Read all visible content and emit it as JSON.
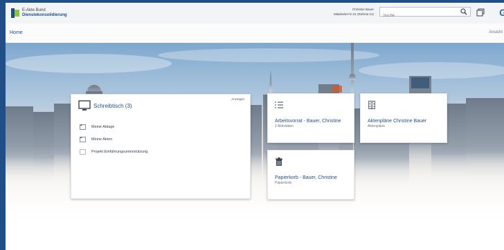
{
  "header": {
    "logo_line1": "E-Akte Bund",
    "logo_line2": "Dienstekonsolidierung",
    "user_name": "Christine Bauer",
    "user_role": "Mitarbeiter*in 21 (Referat 21)",
    "search_placeholder": "Suche",
    "brand_glyph": "G"
  },
  "breadcrumb": {
    "home": "Home",
    "view": "Ansicht"
  },
  "desk": {
    "title": "Schreibtisch (3)",
    "action": "Anzeigen",
    "items": [
      {
        "label": "Meine Ablage",
        "icon": "folder-icon"
      },
      {
        "label": "Meine Akten",
        "icon": "folder-icon"
      },
      {
        "label": "Projekt Einführungsunterstützung",
        "icon": "folder-icon"
      }
    ]
  },
  "tiles": [
    {
      "title": "Arbeitsvorrat - Bauer, Christine",
      "subtitle": "2 Aktivitäten",
      "icon": "list-icon"
    },
    {
      "title": "Aktenpläne Christine Bauer",
      "subtitle": "Aktenpläne",
      "icon": "cabinet-icon"
    },
    {
      "title": "Papierkorb - Bauer, Christine",
      "subtitle": "Papierkorb",
      "icon": "trash-icon"
    }
  ],
  "colors": {
    "brand": "#1f4f86",
    "accent": "#1f6fb8",
    "logo_green": "#8cc63f"
  }
}
